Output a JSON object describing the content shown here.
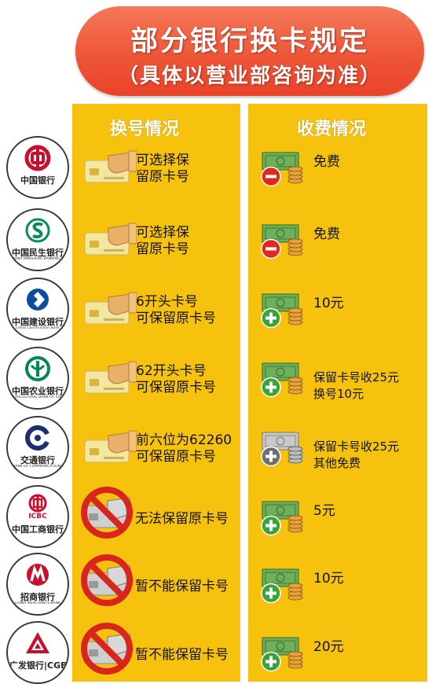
{
  "header": {
    "title": "部分银行换卡规定",
    "subtitle": "（具体以营业部咨询为准）"
  },
  "columns": {
    "swap": "换号情况",
    "fee": "收费情况"
  },
  "rows": [
    {
      "bank_name": "中国银行",
      "bank_en": "",
      "logo_color": "#c8102e",
      "logo_icon": "boc-logo-icon",
      "swap_icon": "card-hand-icon",
      "swap_line1": "可选择保",
      "swap_line2": "留原卡号",
      "fee_icon": "money-minus-icon",
      "fee_line1": "免费",
      "fee_line2": ""
    },
    {
      "bank_name": "中国民生银行",
      "bank_en": "CHINA MINSHENG BANKING CORP., LTD.",
      "logo_color": "#0b8a5e",
      "logo_icon": "cmbc-logo-icon",
      "swap_icon": "card-hand-icon",
      "swap_line1": "可选择保",
      "swap_line2": "留原卡号",
      "fee_icon": "money-minus-icon",
      "fee_line1": "免费",
      "fee_line2": ""
    },
    {
      "bank_name": "中国建设银行",
      "bank_en": "China Construction Bank",
      "logo_color": "#0c4da2",
      "logo_icon": "ccb-logo-icon",
      "swap_icon": "card-hand-icon",
      "swap_line1": "6开头卡号",
      "swap_line2": "可保留原卡号",
      "fee_icon": "money-plus-icon",
      "fee_line1": "10元",
      "fee_line2": ""
    },
    {
      "bank_name": "中国农业银行",
      "bank_en": "AGRICULTURAL BANK OF CHINA",
      "logo_color": "#00875a",
      "logo_icon": "abc-logo-icon",
      "swap_icon": "card-hand-icon",
      "swap_line1": "62开头卡号",
      "swap_line2": "可保留原卡号",
      "fee_icon": "money-plus-icon",
      "fee_line1": "保留卡号收25元",
      "fee_line2": "换号10元"
    },
    {
      "bank_name": "交通银行",
      "bank_en": "BANK OF COMMUNICATIONS",
      "logo_color": "#1d2f6e",
      "logo_icon": "bocom-logo-icon",
      "swap_icon": "card-hand-icon",
      "swap_line1": "前六位为62260",
      "swap_line2": "可保留原卡号",
      "fee_icon": "money-plus-gray-icon",
      "fee_line1": "保留卡号收25元",
      "fee_line2": "其他免费"
    },
    {
      "bank_name": "中国工商银行",
      "bank_en": "",
      "logo_color": "#c8102e",
      "logo_icon": "icbc-logo-icon",
      "swap_icon": "card-forbidden-icon",
      "swap_line1": "无法保留原卡号",
      "swap_line2": "",
      "fee_icon": "money-plus-icon",
      "fee_line1": "5元",
      "fee_line2": ""
    },
    {
      "bank_name": "招商银行",
      "bank_en": "CHINA MERCHANTS BANK",
      "logo_color": "#c8102e",
      "logo_icon": "cmb-logo-icon",
      "swap_icon": "card-forbidden-icon",
      "swap_line1": "暂不能保留卡号",
      "swap_line2": "",
      "fee_icon": "money-plus-icon",
      "fee_line1": "10元",
      "fee_line2": ""
    },
    {
      "bank_name": "广发银行|CGB",
      "bank_en": "",
      "logo_color": "#c8102e",
      "logo_icon": "cgb-logo-icon",
      "swap_icon": "card-forbidden-icon",
      "swap_line1": "暂不能保留卡号",
      "swap_line2": "",
      "fee_icon": "money-plus-icon",
      "fee_line1": "20元",
      "fee_line2": ""
    }
  ]
}
